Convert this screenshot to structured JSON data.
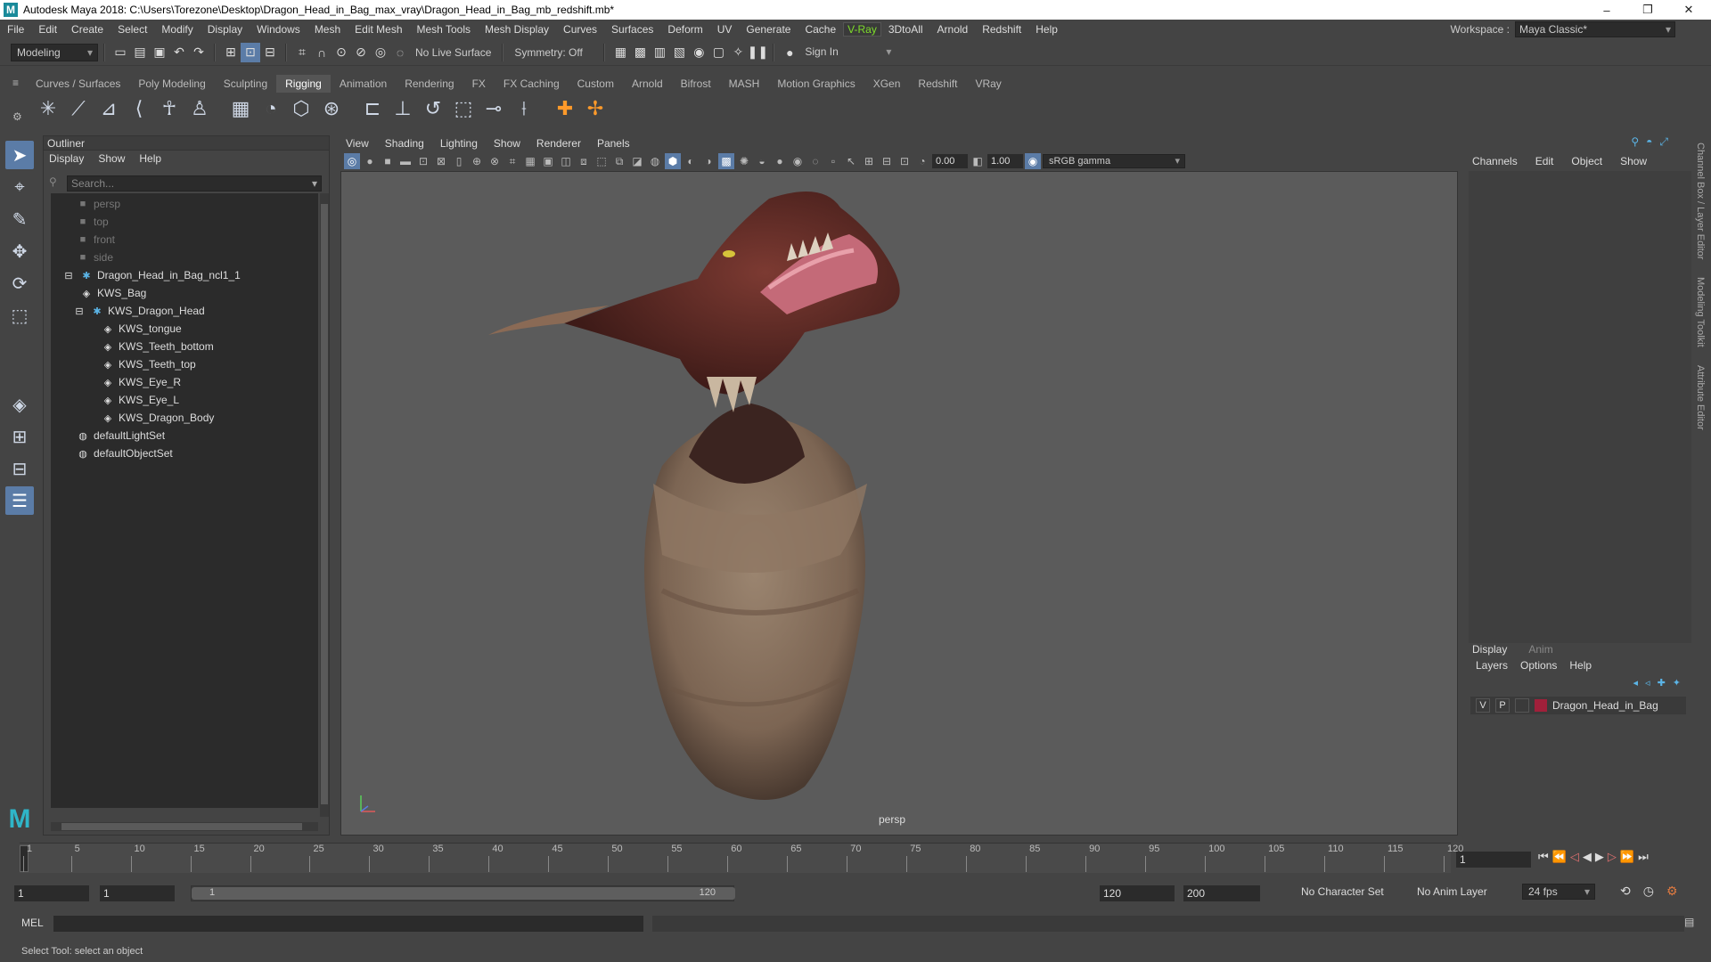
{
  "window": {
    "title": "Autodesk Maya 2018: C:\\Users\\Torezone\\Desktop\\Dragon_Head_in_Bag_max_vray\\Dragon_Head_in_Bag_mb_redshift.mb*",
    "minimize": "–",
    "restore": "❐",
    "close": "✕"
  },
  "menubar": {
    "items": [
      "File",
      "Edit",
      "Create",
      "Select",
      "Modify",
      "Display",
      "Windows",
      "Mesh",
      "Edit Mesh",
      "Mesh Tools",
      "Mesh Display",
      "Curves",
      "Surfaces",
      "Deform",
      "UV",
      "Generate",
      "Cache",
      "V-Ray",
      "3DtoAll",
      "Arnold",
      "Redshift",
      "Help"
    ],
    "workspace_label": "Workspace :",
    "workspace_value": "Maya Classic*"
  },
  "statusline": {
    "mode": "Modeling",
    "live_surface": "No Live Surface",
    "symmetry": "Symmetry: Off",
    "sign_in": "Sign In"
  },
  "shelf": {
    "tabs": [
      "Curves / Surfaces",
      "Poly Modeling",
      "Sculpting",
      "Rigging",
      "Animation",
      "Rendering",
      "FX",
      "FX Caching",
      "Custom",
      "Arnold",
      "Bifrost",
      "MASH",
      "Motion Graphics",
      "XGen",
      "Redshift",
      "VRay"
    ],
    "active_tab": "Rigging"
  },
  "outliner": {
    "title": "Outliner",
    "menu": [
      "Display",
      "Show",
      "Help"
    ],
    "search_placeholder": "Search...",
    "items": [
      {
        "label": "persp",
        "depth": 0,
        "dim": true,
        "icon": "camera-icon"
      },
      {
        "label": "top",
        "depth": 0,
        "dim": true,
        "icon": "camera-icon"
      },
      {
        "label": "front",
        "depth": 0,
        "dim": true,
        "icon": "camera-icon"
      },
      {
        "label": "side",
        "depth": 0,
        "dim": true,
        "icon": "camera-icon"
      },
      {
        "label": "Dragon_Head_in_Bag_ncl1_1",
        "depth": 0,
        "dim": false,
        "icon": "group-icon"
      },
      {
        "label": "KWS_Bag",
        "depth": 1,
        "dim": false,
        "icon": "mesh-icon"
      },
      {
        "label": "KWS_Dragon_Head",
        "depth": 1,
        "dim": false,
        "icon": "group-icon"
      },
      {
        "label": "KWS_tongue",
        "depth": 2,
        "dim": false,
        "icon": "mesh-icon"
      },
      {
        "label": "KWS_Teeth_bottom",
        "depth": 2,
        "dim": false,
        "icon": "mesh-icon"
      },
      {
        "label": "KWS_Teeth_top",
        "depth": 2,
        "dim": false,
        "icon": "mesh-icon"
      },
      {
        "label": "KWS_Eye_R",
        "depth": 2,
        "dim": false,
        "icon": "mesh-icon"
      },
      {
        "label": "KWS_Eye_L",
        "depth": 2,
        "dim": false,
        "icon": "mesh-icon"
      },
      {
        "label": "KWS_Dragon_Body",
        "depth": 2,
        "dim": false,
        "icon": "mesh-icon"
      },
      {
        "label": "defaultLightSet",
        "depth": 0,
        "dim": false,
        "icon": "set-icon"
      },
      {
        "label": "defaultObjectSet",
        "depth": 0,
        "dim": false,
        "icon": "set-icon"
      }
    ]
  },
  "viewport": {
    "menu": [
      "View",
      "Shading",
      "Lighting",
      "Show",
      "Renderer",
      "Panels"
    ],
    "exposure": "0.00",
    "gamma": "1.00",
    "color_space": "sRGB gamma",
    "camera_label": "persp"
  },
  "channelbox": {
    "menu": [
      "Channels",
      "Edit",
      "Object",
      "Show"
    ],
    "side_tabs": [
      "Channel Box / Layer Editor",
      "Modeling Toolkit",
      "Attribute Editor"
    ]
  },
  "layers": {
    "tabs": [
      "Display",
      "Anim"
    ],
    "menu": [
      "Layers",
      "Options",
      "Help"
    ],
    "layer": {
      "v": "V",
      "p": "P",
      "name": "Dragon_Head_in_Bag",
      "color": "#a0203a"
    }
  },
  "timeline": {
    "ticks": [
      "1",
      "5",
      "10",
      "15",
      "20",
      "25",
      "30",
      "35",
      "40",
      "45",
      "50",
      "55",
      "60",
      "65",
      "70",
      "75",
      "80",
      "85",
      "90",
      "95",
      "100",
      "105",
      "110",
      "115",
      "120"
    ],
    "current_frame": "1"
  },
  "range": {
    "start": "1",
    "playback_start": "1",
    "slider_start": "1",
    "slider_end": "120",
    "playback_end": "120",
    "end": "200",
    "character_set": "No Character Set",
    "anim_layer": "No Anim Layer",
    "fps": "24 fps"
  },
  "commandline": {
    "label": "MEL",
    "help": "Select Tool: select an object"
  }
}
